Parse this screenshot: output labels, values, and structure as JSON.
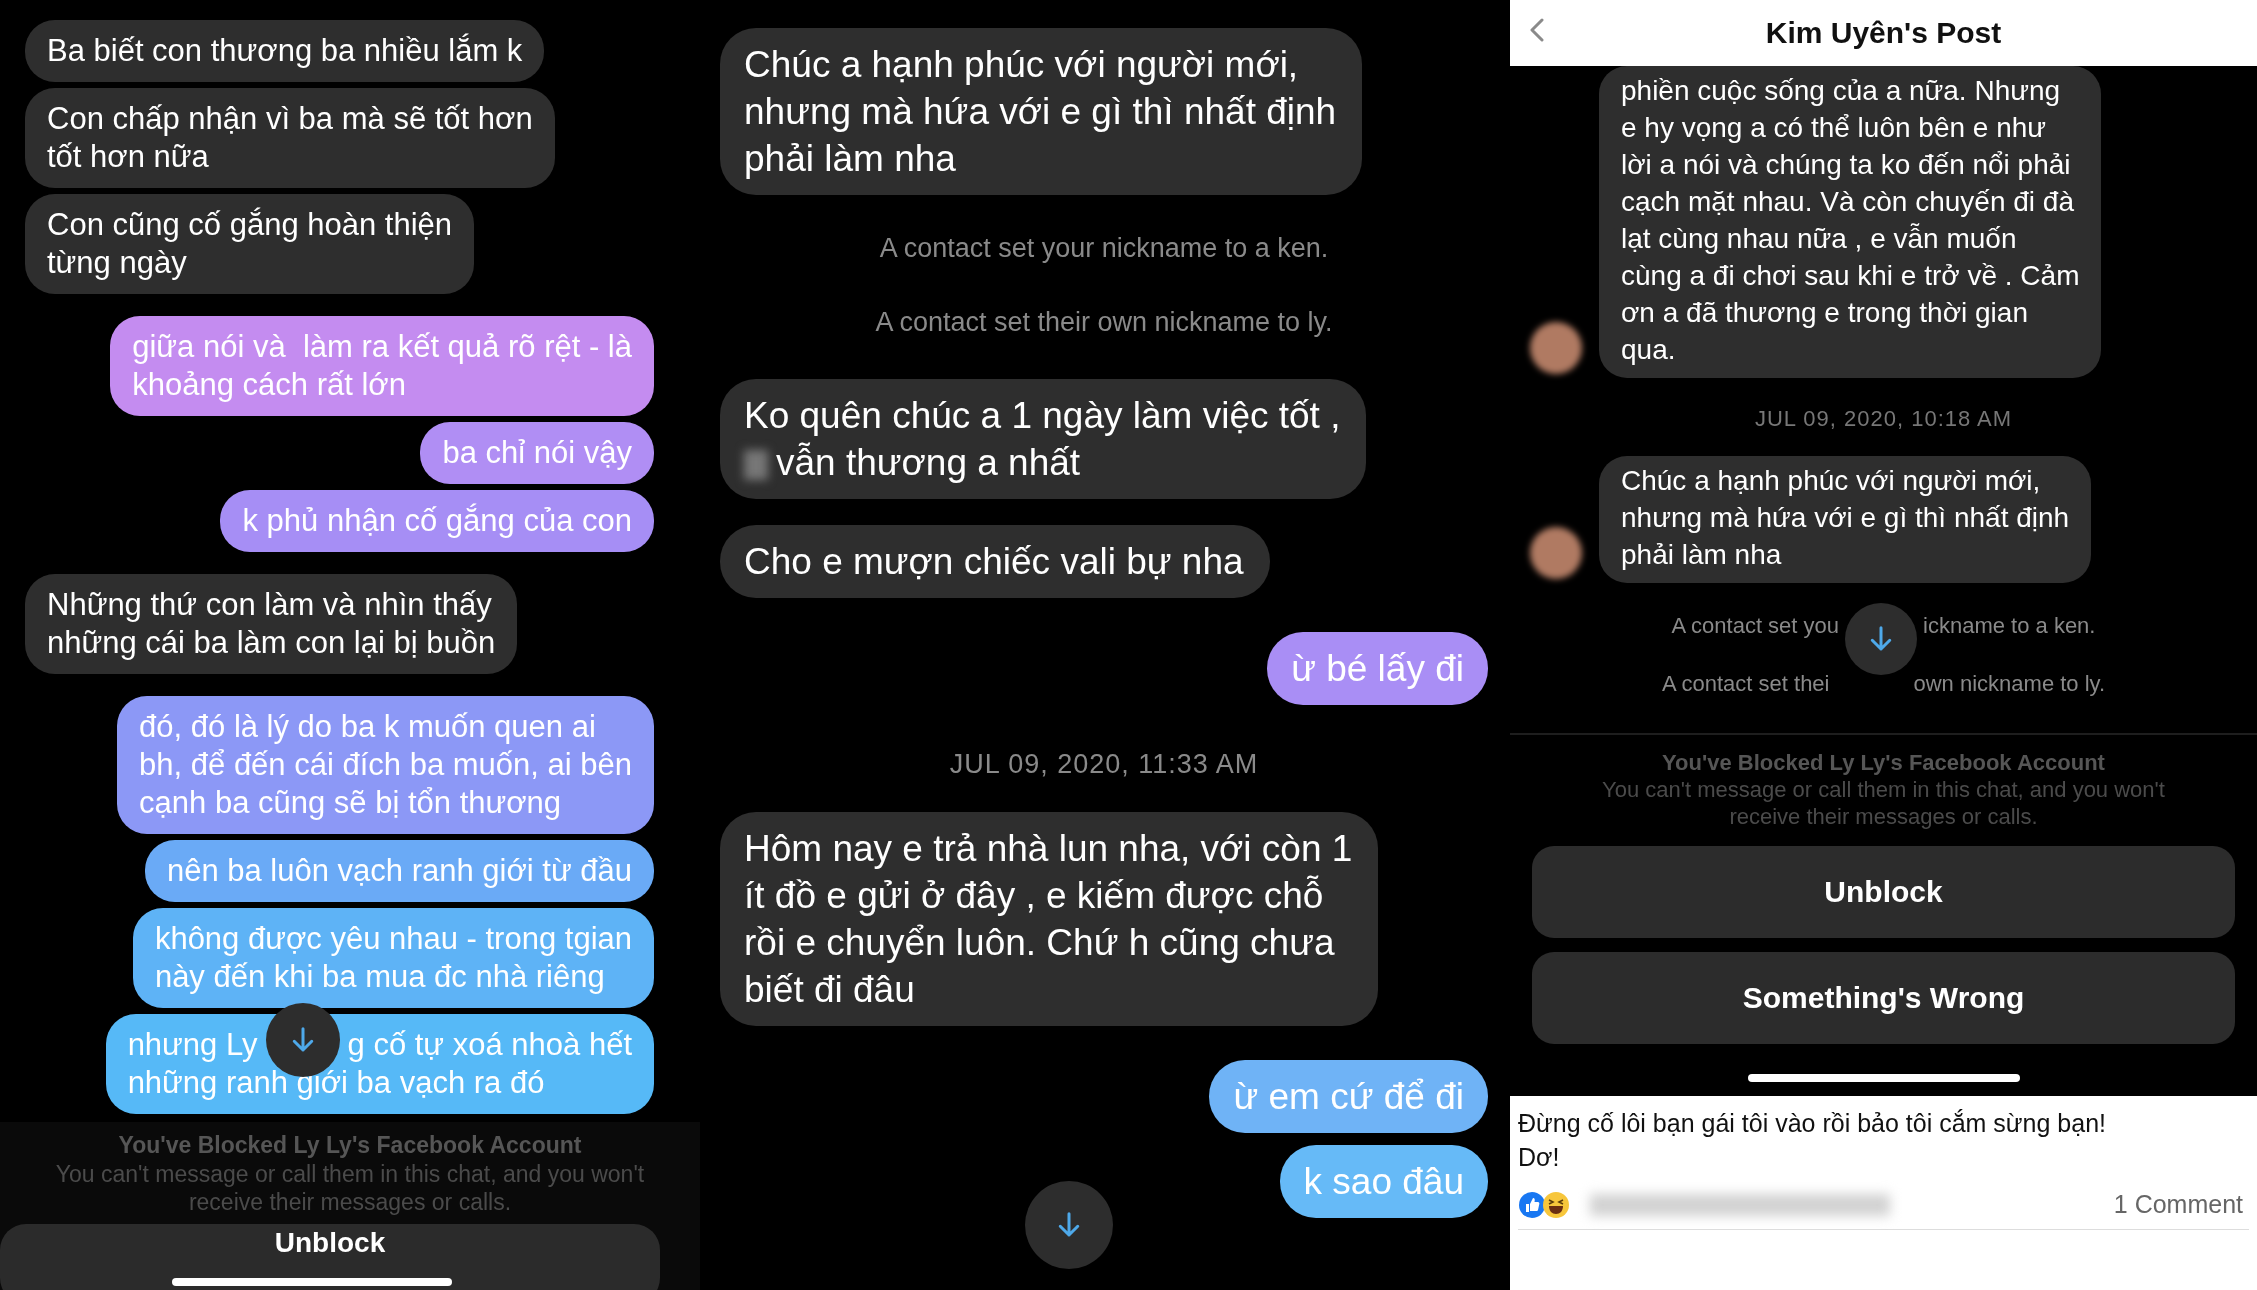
{
  "left_chat": {
    "messages": [
      {
        "kind": "received",
        "text": "Ba biết con thương ba nhiều lắm k"
      },
      {
        "kind": "received",
        "text": "Con chấp nhận vì ba mà sẽ tốt hơn\ntốt hơn nữa"
      },
      {
        "kind": "received",
        "text": "Con cũng cố gắng hoàn thiện\ntừng ngày"
      },
      {
        "kind": "sent",
        "color": "#c48cf0",
        "text": "giữa nói và  làm ra kết quả rõ rệt - là\nkhoảng cách rất lớn"
      },
      {
        "kind": "sent",
        "color": "#b08ef4",
        "text": "ba chỉ nói vậy"
      },
      {
        "kind": "sent",
        "color": "#a68ef5",
        "text": "k phủ nhận cố gắng của con"
      },
      {
        "kind": "received",
        "text": "Những thứ con làm và nhìn thấy\nnhững cái ba làm con lại bị buồn"
      },
      {
        "kind": "sent",
        "color": "#8c98f6",
        "text": "đó, đó là lý do ba k muốn quen ai\nbh, để đến cái đích ba muốn, ai bên\ncạnh ba cũng sẽ bị tổn thương"
      },
      {
        "kind": "sent",
        "color": "#6aaaf6",
        "text": "nên ba luôn vạch ranh giới từ đầu"
      },
      {
        "kind": "sent",
        "color": "#5eb3f6",
        "text": "không được yêu nhau - trong tgian\nnày đến khi ba mua đc nhà riêng"
      },
      {
        "kind": "sent",
        "color": "#56b9f7",
        "segments": [
          "nhưng Ly",
          "g cố tự xoá nhoà hết"
        ],
        "text": "những ranh giới ba vạch ra đó"
      }
    ],
    "blocked_notice": {
      "title": "You've Blocked Ly Ly's Facebook Account",
      "message": "You can't message or call them in this chat, and you won't\nreceive their messages or calls."
    },
    "buttons": [
      "Unblock"
    ]
  },
  "middle_chat": {
    "messages": [
      {
        "kind": "received",
        "text": "Chúc a hạnh phúc với người mới,\nnhưng mà hứa với e gì thì nhất định\nphải làm nha"
      },
      {
        "kind": "system",
        "text": "A contact set your nickname to a ken."
      },
      {
        "kind": "system",
        "text": "A contact set their own nickname to ly."
      },
      {
        "kind": "received",
        "text": "Ko quên chúc a 1 ngày làm việc tốt ,",
        "after_redaction": "vẫn thương a nhất"
      },
      {
        "kind": "received",
        "text": "Cho e mượn chiếc vali bự nha"
      },
      {
        "kind": "sent",
        "color": "#a98ef5",
        "text": "ừ bé lấy đi"
      },
      {
        "kind": "date",
        "text": "JUL 09, 2020, 11:33 AM"
      },
      {
        "kind": "received",
        "text": "Hôm nay e trả nhà lun nha, với còn 1\nít đồ e gửi ở đây , e kiếm được chỗ\nrồi e chuyển luôn. Chứ h cũng chưa\nbiết đi đâu"
      },
      {
        "kind": "sent",
        "color": "#6fb3f6",
        "text": "ừ em cứ để đi"
      },
      {
        "kind": "sent",
        "color": "#66baf7",
        "text": "k sao đâu"
      }
    ]
  },
  "post_view": {
    "title": "Kim Uyên's Post",
    "messages": [
      {
        "kind": "received",
        "avatar": true,
        "text": "phiền cuộc sống của a nữa. Nhưng\ne hy vọng a có thể luôn bên e như\nlời a nói và chúng ta ko đến nổi phải\ncạch mặt nhau. Và còn chuyến đi đà\nlạt cùng nhau nữa , e vẫn muốn\ncùng a đi chơi sau khi e trở về . Cảm\nơn a đã thương e trong thời gian\nqua."
      },
      {
        "kind": "date",
        "text": "JUL 09, 2020, 10:18 AM"
      },
      {
        "kind": "received",
        "avatar": true,
        "text": "Chúc a hạnh phúc với người mới,\nnhưng mà hứa với e gì thì nhất định\nphải làm nha"
      },
      {
        "kind": "system",
        "segments": [
          "A contact set you",
          "ickname to a ken."
        ]
      },
      {
        "kind": "system",
        "segments": [
          "A contact set thei",
          "own nickname to ly."
        ]
      }
    ],
    "blocked_notice": {
      "title": "You've Blocked Ly Ly's Facebook Account",
      "message": "You can't message or call them in this chat, and you won't\nreceive their messages or calls."
    },
    "buttons": [
      "Unblock",
      "Something's Wrong"
    ],
    "post": {
      "text": "Đừng cố lôi bạn gái tôi vào rồi bảo tôi cắm sừng bạn!\nDơ!",
      "comments": "1 Comment"
    }
  }
}
